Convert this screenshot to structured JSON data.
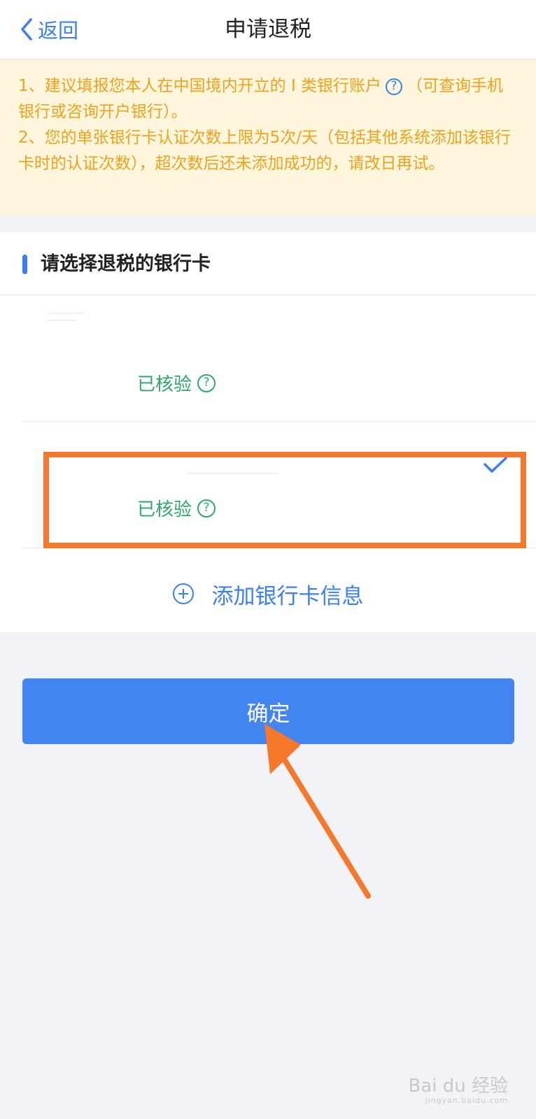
{
  "nav": {
    "back_label": "返回",
    "title": "申请退税"
  },
  "notice": {
    "line1_a": "1、建议填报您本人在中国境内开立的 I 类银行账户",
    "line1_b": "（可查询手机银行或咨询开户银行）。",
    "line2": "2、您的单张银行卡认证次数上限为5次/天（包括其他系统添加该银行卡时的认证次数），超次数后还未添加成功的，请改日再试。",
    "help_glyph": "?"
  },
  "section": {
    "title": "请选择退税的银行卡"
  },
  "bank_cards": [
    {
      "status": "已核验",
      "help_glyph": "?",
      "selected": false
    },
    {
      "status": "已核验",
      "help_glyph": "?",
      "selected": true
    }
  ],
  "add_card": {
    "label": "添加银行卡信息"
  },
  "confirm": {
    "label": "确定"
  },
  "watermark": {
    "brand": "Bai du 经验",
    "url": "jingyan.baidu.com"
  },
  "colors": {
    "accent": "#3a7ff6",
    "verified": "#2fa86a",
    "notice_text": "#f0a21a",
    "notice_bg": "#fdf6dd",
    "highlight": "#f6782a",
    "button": "#4285f0"
  },
  "icons": {
    "back": "chevron-left-icon",
    "help": "question-circle-icon",
    "check": "check-icon",
    "add": "plus-circle-icon",
    "annotation": "arrow-icon"
  }
}
